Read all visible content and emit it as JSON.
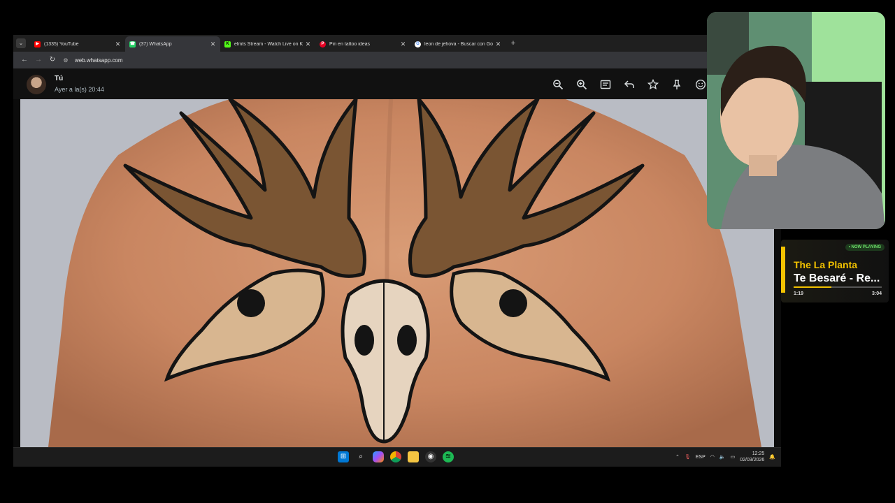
{
  "browser": {
    "tabs": [
      {
        "title": "(1335) YouTube",
        "favicon_color": "#ff0000",
        "active": false
      },
      {
        "title": "(37) WhatsApp",
        "favicon_color": "#25d366",
        "active": true
      },
      {
        "title": "elmts Stream - Watch Live on K",
        "favicon_color": "#53fc18",
        "active": false
      },
      {
        "title": "Pin en tattoo ideas",
        "favicon_color": "#e60023",
        "active": false
      },
      {
        "title": "leon de jehova - Buscar con Go",
        "favicon_color": "#4285f4",
        "active": false
      }
    ],
    "url": "web.whatsapp.com"
  },
  "viewer": {
    "sender_name": "Tú",
    "sender_time": "Ayer a la(s) 20:44",
    "actions": [
      "zoom-out-icon",
      "zoom-in-icon",
      "caption-icon",
      "reply-icon",
      "star-icon",
      "pin-icon",
      "emoji-icon"
    ]
  },
  "taskbar": {
    "language": "ESP",
    "time": "12:25",
    "date": "02/03/2026"
  },
  "now_playing": {
    "badge": "• NOW PLAYING",
    "artist": "The La Planta",
    "song": "Te Besaré - Re...",
    "current": "1:19",
    "total": "3:04",
    "progress": 0.43
  }
}
